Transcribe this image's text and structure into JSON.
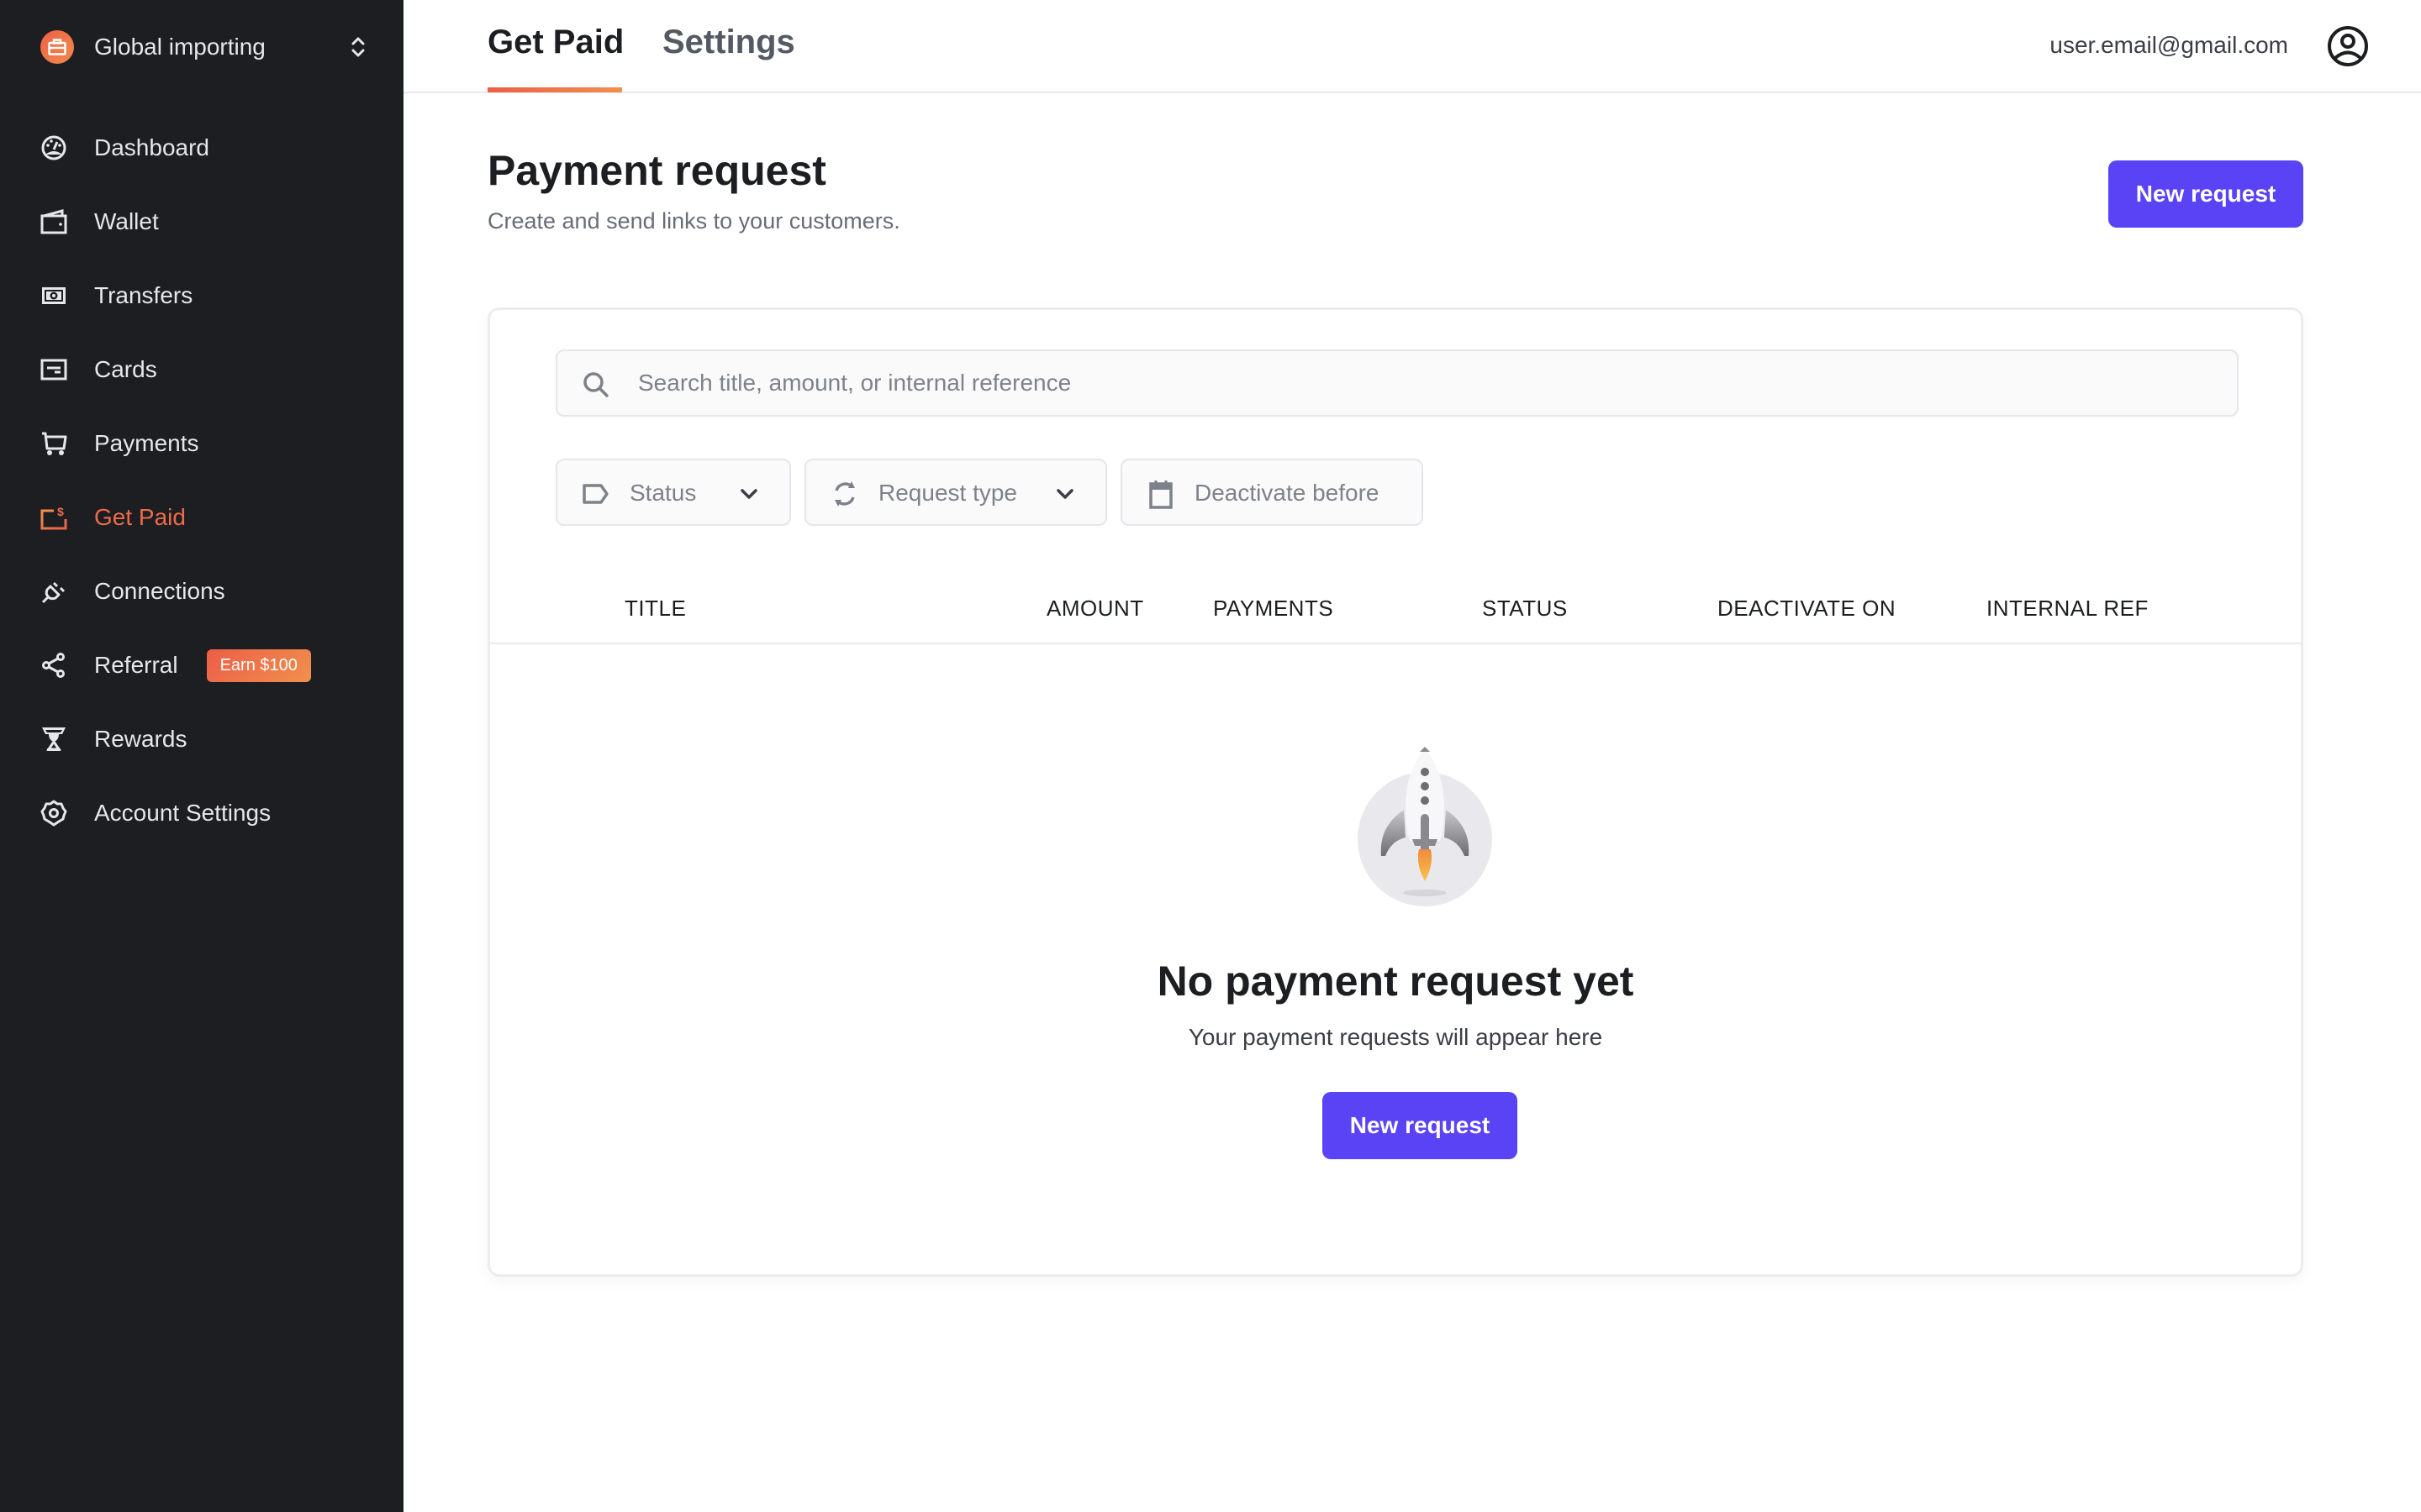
{
  "workspace": {
    "name": "Global importing",
    "icon": "briefcase-icon"
  },
  "sidebar": {
    "items": [
      {
        "label": "Dashboard",
        "icon": "gauge-icon",
        "active": false
      },
      {
        "label": "Wallet",
        "icon": "wallet-icon",
        "active": false
      },
      {
        "label": "Transfers",
        "icon": "banknote-icon",
        "active": false
      },
      {
        "label": "Cards",
        "icon": "card-icon",
        "active": false
      },
      {
        "label": "Payments",
        "icon": "cart-icon",
        "active": false
      },
      {
        "label": "Get Paid",
        "icon": "get-paid-icon",
        "active": true
      },
      {
        "label": "Connections",
        "icon": "plug-icon",
        "active": false
      },
      {
        "label": "Referral",
        "icon": "share-icon",
        "active": false,
        "badge": "Earn $100"
      },
      {
        "label": "Rewards",
        "icon": "trophy-icon",
        "active": false
      },
      {
        "label": "Account Settings",
        "icon": "gear-icon",
        "active": false
      }
    ]
  },
  "header": {
    "tabs": [
      {
        "label": "Get Paid",
        "active": true
      },
      {
        "label": "Settings",
        "active": false
      }
    ],
    "user_email": "user.email@gmail.com"
  },
  "page": {
    "title": "Payment request",
    "subtitle": "Create and send links to your customers.",
    "new_request_label": "New request"
  },
  "filters": {
    "search_placeholder": "Search title, amount, or internal reference",
    "search_value": "",
    "status_label": "Status",
    "request_type_label": "Request type",
    "deactivate_label": "Deactivate before"
  },
  "table": {
    "columns": [
      "TITLE",
      "AMOUNT",
      "PAYMENTS",
      "STATUS",
      "DEACTIVATE ON",
      "INTERNAL REF"
    ],
    "rows": []
  },
  "empty_state": {
    "title": "No payment request yet",
    "subtitle": "Your payment requests will appear here",
    "button_label": "New request"
  },
  "colors": {
    "accent": "#5a43f5",
    "brand_orange": "#ef6a4a",
    "sidebar_bg": "#1c1e22"
  }
}
